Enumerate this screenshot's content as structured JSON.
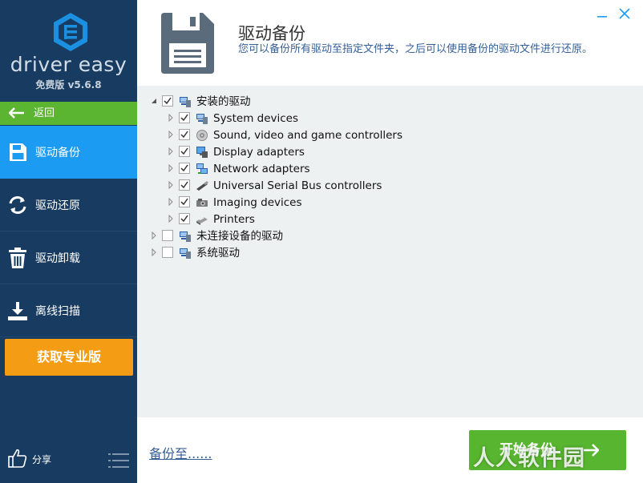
{
  "brand": {
    "name": "driver easy",
    "version": "免费版 v5.6.8",
    "accent_color": "#1b9bf2",
    "sidebar_color": "#183c61"
  },
  "sidebar": {
    "back_label": "返回",
    "items": [
      {
        "label": "驱动备份",
        "icon": "floppy-disk-icon",
        "active": true
      },
      {
        "label": "驱动还原",
        "icon": "restore-arrows-icon",
        "active": false
      },
      {
        "label": "驱动卸载",
        "icon": "trash-icon",
        "active": false
      },
      {
        "label": "离线扫描",
        "icon": "download-tray-icon",
        "active": false
      }
    ],
    "pro_label": "获取专业版",
    "share_label": "分享"
  },
  "header": {
    "title": "驱动备份",
    "description": "您可以备份所有驱动至指定文件夹，之后可以使用备份的驱动文件进行还原。"
  },
  "tree": {
    "nodes": [
      {
        "label": "安装的驱动",
        "level": 0,
        "expanded": true,
        "checked": true,
        "icon": "computer-icon"
      },
      {
        "label": "System devices",
        "level": 1,
        "expanded": false,
        "checked": true,
        "icon": "computer-icon"
      },
      {
        "label": "Sound, video and game controllers",
        "level": 1,
        "expanded": false,
        "checked": true,
        "icon": "speaker-icon"
      },
      {
        "label": "Display adapters",
        "level": 1,
        "expanded": false,
        "checked": true,
        "icon": "monitor-icon"
      },
      {
        "label": "Network adapters",
        "level": 1,
        "expanded": false,
        "checked": true,
        "icon": "network-icon"
      },
      {
        "label": "Universal Serial Bus controllers",
        "level": 1,
        "expanded": false,
        "checked": true,
        "icon": "usb-icon"
      },
      {
        "label": "Imaging devices",
        "level": 1,
        "expanded": false,
        "checked": true,
        "icon": "camera-icon"
      },
      {
        "label": "Printers",
        "level": 1,
        "expanded": false,
        "checked": true,
        "icon": "printer-icon"
      },
      {
        "label": "未连接设备的驱动",
        "level": 0,
        "expanded": false,
        "checked": false,
        "icon": "computer-icon"
      },
      {
        "label": "系统驱动",
        "level": 0,
        "expanded": false,
        "checked": false,
        "icon": "computer-icon"
      }
    ]
  },
  "footer": {
    "backup_to_label": "备份至......",
    "start_label": "开始备份"
  },
  "watermark": "人人软件园"
}
